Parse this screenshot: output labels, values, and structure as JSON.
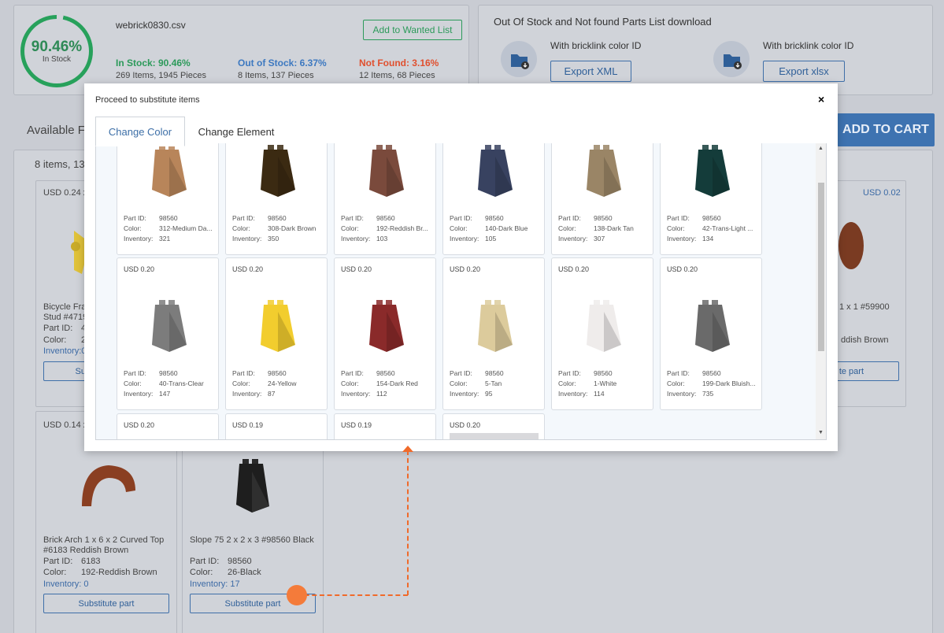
{
  "summary": {
    "gauge_percent": "90.46%",
    "gauge_label": "In Stock",
    "filename": "webrick0830.csv",
    "add_wanted_label": "Add to Wanted List",
    "in_stock_title": "In Stock: 90.46%",
    "in_stock_detail": "269 Items, 1945 Pieces",
    "out_stock_title": "Out of Stock: 6.37%",
    "out_stock_detail": "8 Items, 137 Pieces",
    "not_found_title": "Not Found: 3.16%",
    "not_found_detail": "12 Items, 68 Pieces"
  },
  "export": {
    "title": "Out Of Stock and Not found Parts List download",
    "xml_caption": "With bricklink color ID",
    "xml_button": "Export XML",
    "xlsx_caption": "With bricklink color ID",
    "xlsx_button": "Export xlsx"
  },
  "page": {
    "available_heading": "Available F",
    "items_count": "8 items, 13",
    "add_to_cart": "ADD TO CART"
  },
  "bg_cards": {
    "c1_price": "USD 0.24 x",
    "c1_name1": "Bicycle Fra",
    "c1_name2": "Stud #4719",
    "c1_partid": "Part ID:",
    "c1_partid_val": "4",
    "c1_color": "Color:",
    "c1_color_val": "2",
    "c1_inv": "Inventory:0",
    "c1_btn": "Su",
    "c2_price": "USD 0.02",
    "c2_name": "1 x 1 #59900",
    "c2_color": "ddish Brown",
    "c2_btn": "te part",
    "c3_price": "USD 0.14 x",
    "c3_name1": "Brick Arch 1 x 6 x 2 Curved Top",
    "c3_name2": "#6183 Reddish Brown",
    "c3_partid": "Part ID:",
    "c3_partid_val": "6183",
    "c3_color": "Color:",
    "c3_color_val": "192-Reddish Brown",
    "c3_inv": "Inventory: 0",
    "c3_btn": "Substitute part",
    "c4_name": "Slope 75 2 x 2 x 3 #98560 Black",
    "c4_partid": "Part ID:",
    "c4_partid_val": "98560",
    "c4_color": "Color:",
    "c4_color_val": "26-Black",
    "c4_inv": "Inventory: 17",
    "c4_btn": "Substitute part"
  },
  "modal": {
    "title": "Proceed to substitute items",
    "close": "×",
    "tab_color": "Change Color",
    "tab_element": "Change Element",
    "labels": {
      "part": "Part ID:",
      "color": "Color:",
      "inventory": "Inventory:"
    },
    "row1": [
      {
        "price": "",
        "part": "98560",
        "color": "312-Medium Da...",
        "inv": "321",
        "hex": "#b8855a"
      },
      {
        "price": "",
        "part": "98560",
        "color": "308-Dark Brown",
        "inv": "350",
        "hex": "#3b2a12"
      },
      {
        "price": "",
        "part": "98560",
        "color": "192-Reddish Br...",
        "inv": "103",
        "hex": "#7a4a3c"
      },
      {
        "price": "",
        "part": "98560",
        "color": "140-Dark Blue",
        "inv": "105",
        "hex": "#384260"
      },
      {
        "price": "",
        "part": "98560",
        "color": "138-Dark Tan",
        "inv": "307",
        "hex": "#9a8566"
      },
      {
        "price": "",
        "part": "98560",
        "color": "42-Trans-Light ...",
        "inv": "134",
        "hex": "#143c3a"
      }
    ],
    "row2": [
      {
        "price": "USD 0.20",
        "part": "98560",
        "color": "40-Trans-Clear",
        "inv": "147",
        "hex": "#7c7c7c"
      },
      {
        "price": "USD 0.20",
        "part": "98560",
        "color": "24-Yellow",
        "inv": "87",
        "hex": "#f2cd2e"
      },
      {
        "price": "USD 0.20",
        "part": "98560",
        "color": "154-Dark Red",
        "inv": "112",
        "hex": "#8a2a2a"
      },
      {
        "price": "USD 0.20",
        "part": "98560",
        "color": "5-Tan",
        "inv": "95",
        "hex": "#dccb9c"
      },
      {
        "price": "USD 0.20",
        "part": "98560",
        "color": "1-White",
        "inv": "114",
        "hex": "#efeceb"
      },
      {
        "price": "USD 0.20",
        "part": "98560",
        "color": "199-Dark Bluish...",
        "inv": "735",
        "hex": "#6a6a6a"
      }
    ],
    "row3": [
      {
        "price": "USD 0.20"
      },
      {
        "price": "USD 0.19"
      },
      {
        "price": "USD 0.19"
      },
      {
        "price": "USD 0.20"
      }
    ]
  },
  "colors": {
    "accent_blue": "#3e73b1",
    "in_stock_green": "#2c9a5a",
    "out_stock_blue": "#3c78c0",
    "not_found_red": "#e0502f",
    "annotation_orange": "#f06a2a"
  }
}
